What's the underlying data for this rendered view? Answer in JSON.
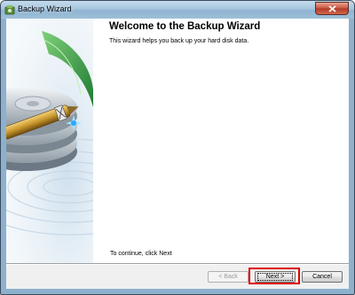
{
  "window": {
    "title": "Backup Wizard",
    "app_icon": "backup-wizard-icon",
    "close_icon": "close-icon"
  },
  "content": {
    "heading": "Welcome to the Backup Wizard",
    "subtitle": "This wizard helps you back up your hard disk data.",
    "footer_hint": "To continue, click Next"
  },
  "buttons": {
    "back_label": "< Back",
    "next_label": "Next >",
    "cancel_label": "Cancel"
  },
  "sidebar": {
    "illustration": "hard-disk-with-pen-illustration"
  },
  "colors": {
    "highlight": "#e00000",
    "titlebar": "#a6c6de",
    "pen_gold": "#c8962a",
    "disk_green": "#3a9a4a"
  }
}
